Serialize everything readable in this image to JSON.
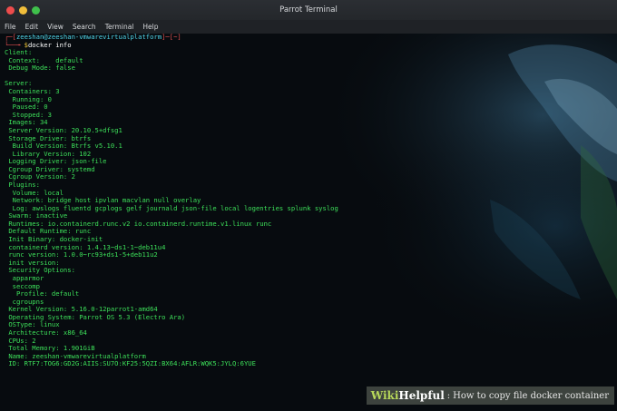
{
  "window": {
    "title": "Parrot Terminal"
  },
  "menu": [
    "File",
    "Edit",
    "View",
    "Search",
    "Terminal",
    "Help"
  ],
  "colors": {
    "output_green": "#3de05a",
    "prompt_red": "#e05050",
    "prompt_user_cyan": "#4fd4e8",
    "prompt_dollar_yellow": "#f0c838"
  },
  "prompt": {
    "open": "┌─[",
    "user_host": "zeeshan@zeeshan-vmwarevirtualplatform",
    "close": "]─[~]",
    "arrow": "└──╼ ",
    "dollar": "$",
    "command": "docker info"
  },
  "output": [
    "Client:",
    " Context:    default",
    " Debug Mode: false",
    "",
    "Server:",
    " Containers: 3",
    "  Running: 0",
    "  Paused: 0",
    "  Stopped: 3",
    " Images: 34",
    " Server Version: 20.10.5+dfsg1",
    " Storage Driver: btrfs",
    "  Build Version: Btrfs v5.10.1",
    "  Library Version: 102",
    " Logging Driver: json-file",
    " Cgroup Driver: systemd",
    " Cgroup Version: 2",
    " Plugins:",
    "  Volume: local",
    "  Network: bridge host ipvlan macvlan null overlay",
    "  Log: awslogs fluentd gcplogs gelf journald json-file local logentries splunk syslog",
    " Swarm: inactive",
    " Runtimes: io.containerd.runc.v2 io.containerd.runtime.v1.linux runc",
    " Default Runtime: runc",
    " Init Binary: docker-init",
    " containerd version: 1.4.13~ds1-1~deb11u4",
    " runc version: 1.0.0~rc93+ds1-5+deb11u2",
    " init version:",
    " Security Options:",
    "  apparmor",
    "  seccomp",
    "   Profile: default",
    "  cgroupns",
    " Kernel Version: 5.16.0-12parrot1-amd64",
    " Operating System: Parrot OS 5.3 (Electro Ara)",
    " OSType: linux",
    " Architecture: x86_64",
    " CPUs: 2",
    " Total Memory: 1.901GiB",
    " Name: zeeshan-vmwarevirtualplatform",
    " ID: RTF7:TOG6:GD2G:AIIS:SU7O:KF25:5QZI:BX64:AFLR:WQK5:JYLQ:6YUE"
  ],
  "watermark": {
    "wiki": "Wiki",
    "helpful": "Helpful",
    "sep": ":",
    "caption": "How to copy file docker  container"
  }
}
